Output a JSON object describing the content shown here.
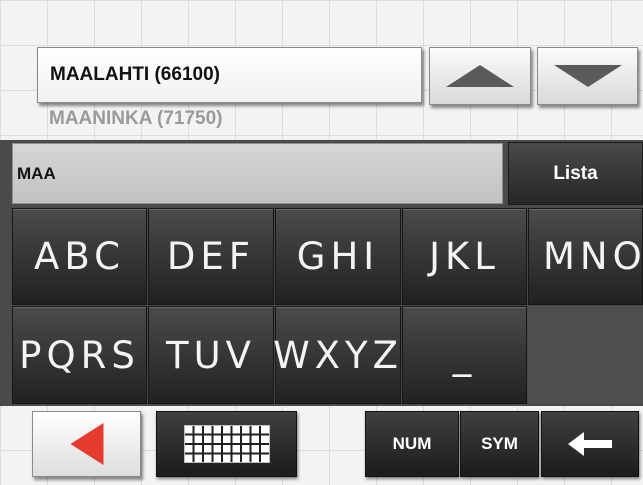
{
  "result": {
    "selected": "MAALAHTI (66100)",
    "next": "MAANINKA (71750)"
  },
  "search": {
    "value": "MAA"
  },
  "buttons": {
    "lista": "Lista",
    "num": "NUM",
    "sym": "SYM"
  },
  "keys": {
    "row1": [
      "ABC",
      "DEF",
      "GHI",
      "JKL",
      "MNO"
    ],
    "row2": [
      "PQRS",
      "TUV",
      "WXYZ",
      "_"
    ]
  },
  "icons": {
    "scroll_up": "triangle-up-icon",
    "scroll_down": "triangle-down-icon",
    "back": "triangle-left-icon",
    "keyboard": "keyboard-grid-icon",
    "backspace": "arrow-left-icon"
  },
  "colors": {
    "back_arrow": "#e53a2e",
    "panel": "#4a4a4a"
  }
}
